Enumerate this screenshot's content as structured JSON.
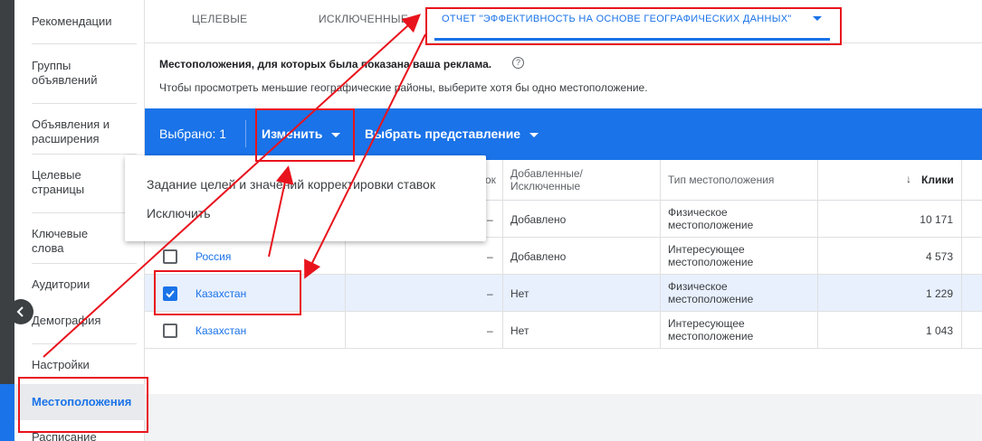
{
  "sidebar": {
    "items": [
      {
        "label": "Рекомендации"
      },
      {
        "label": "Группы объявлений"
      },
      {
        "label": "Объявления и расширения"
      },
      {
        "label": "Целевые страницы"
      },
      {
        "label": "Ключевые слова"
      },
      {
        "label": "Аудитории"
      },
      {
        "label": "Демография"
      },
      {
        "label": "Настройки"
      },
      {
        "label": "Местоположения"
      },
      {
        "label": "Расписание"
      }
    ],
    "active_index": 8
  },
  "tabs": [
    {
      "label": "ЦЕЛЕВЫЕ"
    },
    {
      "label": "ИСКЛЮЧЕННЫЕ"
    },
    {
      "label": "ОТЧЕТ \"ЭФФЕКТИВНОСТЬ НА ОСНОВЕ ГЕОГРАФИЧЕСКИХ ДАННЫХ\""
    }
  ],
  "card": {
    "title": "Местоположения, для которых была показана ваша реклама.",
    "help_icon": "?",
    "subtitle": "Чтобы просмотреть меньшие географические районы, выберите хотя бы одно местоположение."
  },
  "actionbar": {
    "selected": "Выбрано: 1",
    "edit": "Изменить",
    "view": "Выбрать представление"
  },
  "menu": {
    "items": [
      {
        "label": "Задание целей и значений корректировки ставок"
      },
      {
        "label": "Исключить"
      }
    ]
  },
  "table": {
    "headers": {
      "bid_partial": "ок",
      "added": "Добавленные/ Исключенные",
      "type": "Тип местоположения",
      "clicks": "Клики",
      "sort_icon": "↓"
    },
    "rows": [
      {
        "name": "",
        "bid": "–",
        "added": "Добавлено",
        "type": "Физическое местоположение",
        "clicks": "10 171",
        "checked": false
      },
      {
        "name": "Россия",
        "bid": "–",
        "added": "Добавлено",
        "type": "Интересующее местоположение",
        "clicks": "4 573",
        "checked": false
      },
      {
        "name": "Казахстан",
        "bid": "–",
        "added": "Нет",
        "type": "Физическое местоположение",
        "clicks": "1 229",
        "checked": true
      },
      {
        "name": "Казахстан",
        "bid": "–",
        "added": "Нет",
        "type": "Интересующее местоположение",
        "clicks": "1 043",
        "checked": false
      }
    ]
  },
  "colors": {
    "accent": "#1a73e8",
    "annotation": "#e8141d"
  }
}
